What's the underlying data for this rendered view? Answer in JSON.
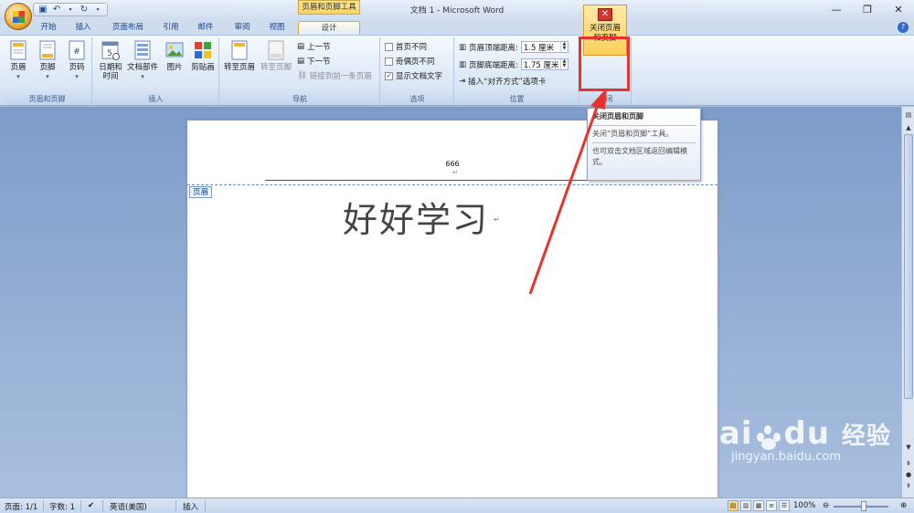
{
  "window": {
    "title": "文档 1 - Microsoft Word",
    "context_group": "页眉和页脚工具",
    "controls": [
      "—",
      "❐",
      "✕"
    ]
  },
  "tabs": [
    {
      "label": "开始",
      "active": false
    },
    {
      "label": "插入",
      "active": false
    },
    {
      "label": "页面布局",
      "active": false
    },
    {
      "label": "引用",
      "active": false
    },
    {
      "label": "邮件",
      "active": false
    },
    {
      "label": "审阅",
      "active": false
    },
    {
      "label": "视图",
      "active": false
    },
    {
      "label": "设计",
      "active": true
    }
  ],
  "ribbon": {
    "hf_group": {
      "label": "页眉和页脚",
      "header": "页眉",
      "footer": "页脚",
      "page_number": "页码"
    },
    "insert_group": {
      "label": "插入",
      "datetime_1": "日期和",
      "datetime_2": "时间",
      "quickparts": "文档部件",
      "picture": "图片",
      "clipart": "剪贴画"
    },
    "nav_group": {
      "label": "导航",
      "goto_header": "转至页眉",
      "goto_footer": "转至页脚",
      "prev": "上一节",
      "next": "下一节",
      "link_prev": "链接到前一条页眉"
    },
    "options_group": {
      "label": "选项",
      "diff_first": "首页不同",
      "diff_odd_even": "奇偶页不同",
      "show_doc_text": "显示文档文字",
      "diff_first_checked": false,
      "diff_odd_even_checked": false,
      "show_doc_text_checked": true
    },
    "position_group": {
      "label": "位置",
      "header_top_label": "页眉顶端距离:",
      "header_top_value": "1.5 厘米",
      "footer_bottom_label": "页脚底端距离:",
      "footer_bottom_value": "1.75 厘米",
      "align_tab": "插入“对齐方式”选项卡"
    },
    "close_group": {
      "label": "关闭",
      "close_1": "关闭页眉",
      "close_2": "和页脚"
    }
  },
  "tooltip": {
    "title": "关闭页眉和页脚",
    "line1": "关闭“页眉和页脚”工具。",
    "line2": "也可双击文档区域返回编辑模式。"
  },
  "document": {
    "header_tag": "页眉",
    "header_text": "666",
    "body_text": "好好学习",
    "para_mark": "↵"
  },
  "statusbar": {
    "page": "页面: 1/1",
    "words": "字数: 1",
    "language": "英语(美国)",
    "mode": "插入",
    "zoom": "100%"
  },
  "watermark": {
    "brand": "Bai",
    "brand2": "du",
    "cn": "经验",
    "url": "jingyan.baidu.com"
  },
  "colors": {
    "highlight": "#e8322c",
    "ribbon_bg": "#dbe7f6",
    "active_tab_border": "#d6a63a"
  }
}
